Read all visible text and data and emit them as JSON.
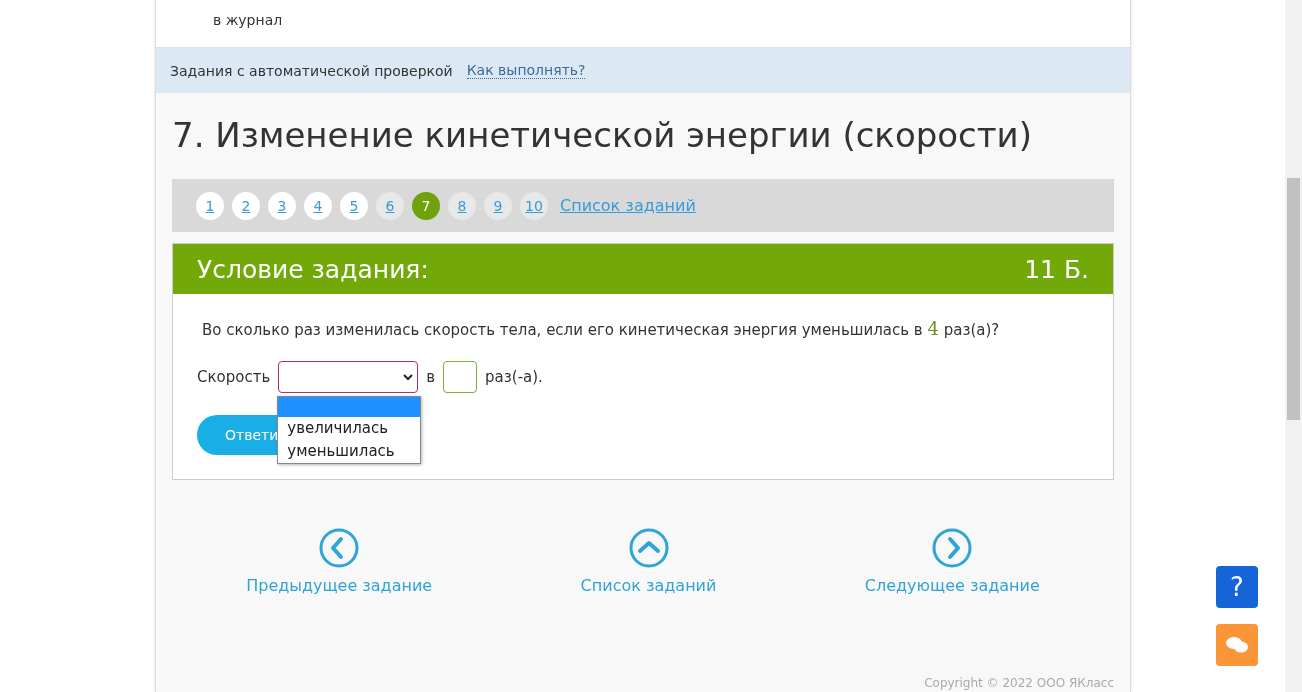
{
  "intro": {
    "text_tail": "в журнал"
  },
  "info_bar": {
    "label": "Задания с автоматической проверкой",
    "link": "Как выполнять?"
  },
  "title": "7. Изменение кинетической энергии (скорости)",
  "pager": {
    "pages": [
      {
        "label": "1",
        "selected": false,
        "visited": false
      },
      {
        "label": "2",
        "selected": false,
        "visited": false
      },
      {
        "label": "3",
        "selected": false,
        "visited": false
      },
      {
        "label": "4",
        "selected": false,
        "visited": false
      },
      {
        "label": "5",
        "selected": false,
        "visited": false
      },
      {
        "label": "6",
        "selected": false,
        "visited": true
      },
      {
        "label": "7",
        "selected": true,
        "visited": true
      },
      {
        "label": "8",
        "selected": false,
        "visited": true
      },
      {
        "label": "9",
        "selected": false,
        "visited": true
      },
      {
        "label": "10",
        "selected": false,
        "visited": true
      }
    ],
    "list_link": "Список заданий"
  },
  "task": {
    "header": "Условие задания:",
    "points": "11 Б.",
    "question": {
      "before": "Во сколько раз изменилась скорость тела, если его кинетическая энергия уменьшилась в",
      "number": "4",
      "after": "раз(а)?"
    },
    "answer": {
      "label": "Скорость",
      "between": "в",
      "after": "раз(-а).",
      "dropdown": {
        "expanded": true,
        "blank_highlighted": true,
        "options": [
          {
            "label": "увеличилась",
            "highlighted": false
          },
          {
            "label": "уменьшилась",
            "highlighted": false
          }
        ]
      }
    },
    "submit": "Ответи"
  },
  "nav": [
    {
      "kind": "prev",
      "label": "Предыдущее задание"
    },
    {
      "kind": "up",
      "label": "Список заданий"
    },
    {
      "kind": "next",
      "label": "Следующее задание"
    }
  ],
  "copyright": "Copyright © 2022 ООО ЯКласс",
  "help_button": "?"
}
